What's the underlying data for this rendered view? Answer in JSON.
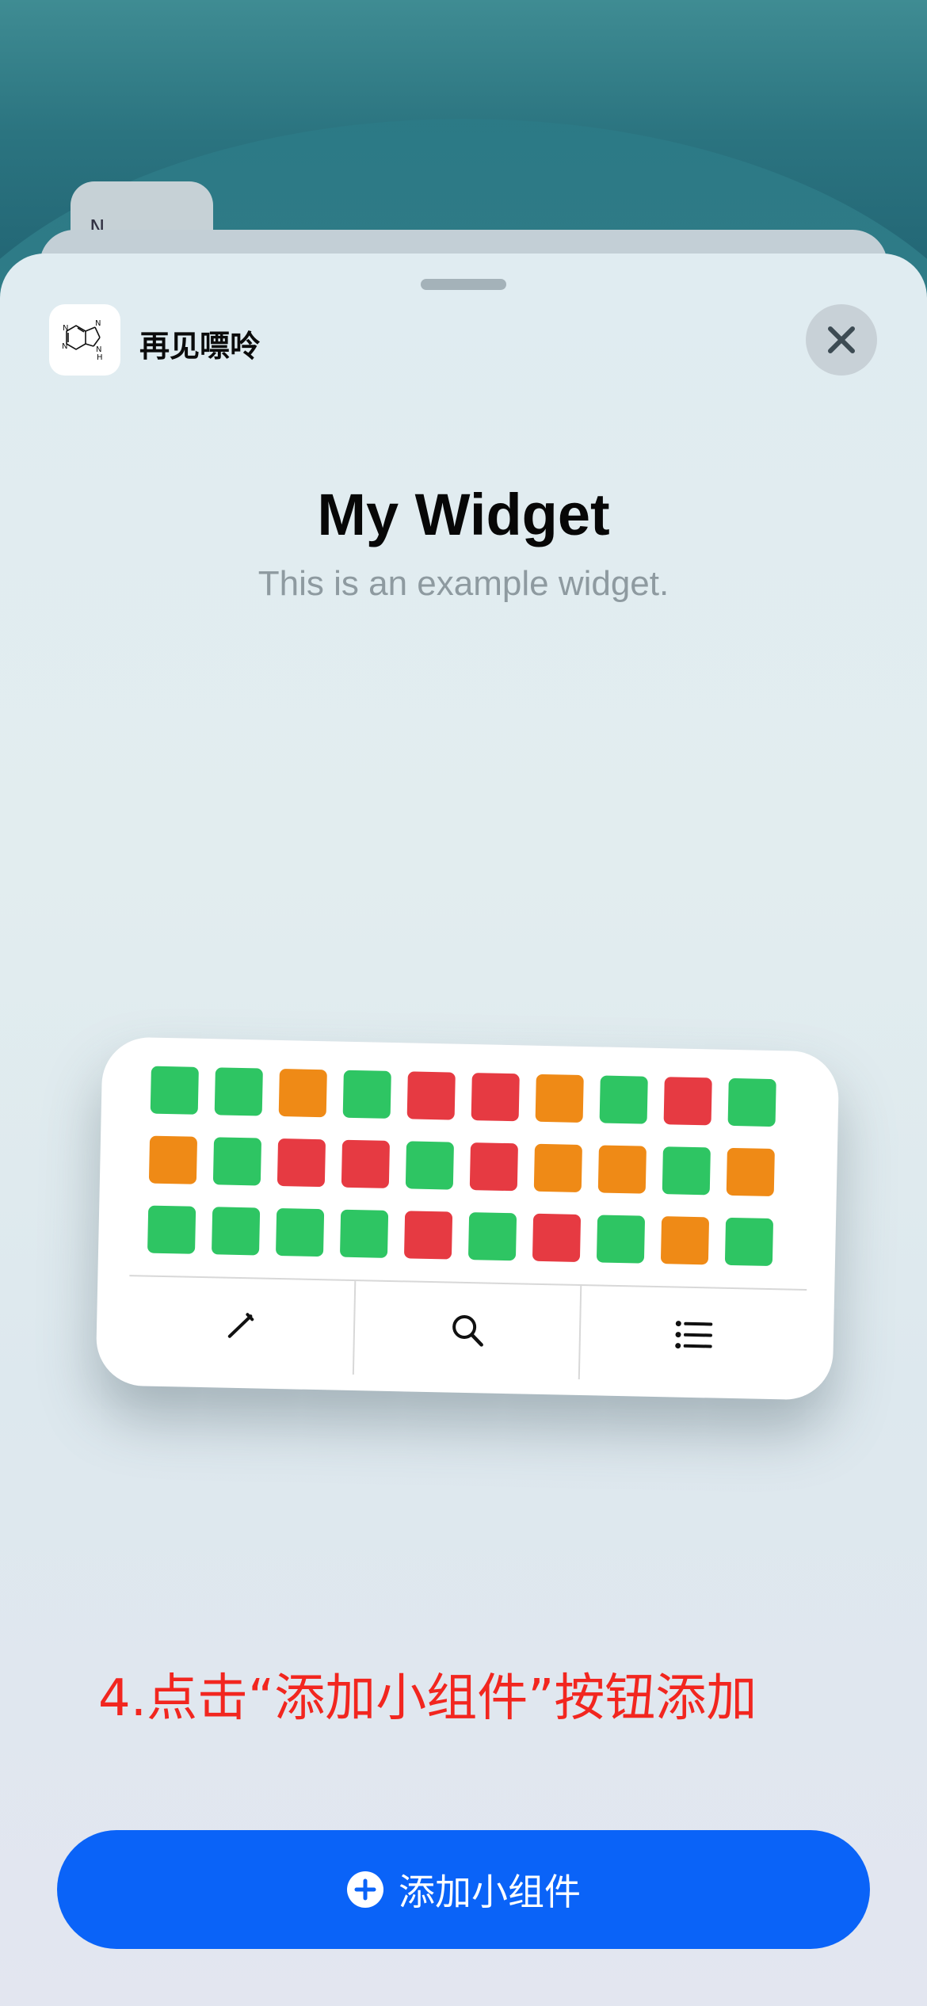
{
  "app": {
    "name": "再见嘌呤",
    "icon": "purine-molecule-icon",
    "ghost_icon_text": "N"
  },
  "sheet": {
    "title": "My Widget",
    "subtitle": "This is an example widget.",
    "close_icon": "close-icon"
  },
  "widget": {
    "colors": {
      "green": "#2ec563",
      "orange": "#ef8a16",
      "red": "#e63a42"
    },
    "rows": [
      [
        "green",
        "green",
        "orange",
        "green",
        "red",
        "red",
        "orange",
        "green",
        "red",
        "green"
      ],
      [
        "orange",
        "green",
        "red",
        "red",
        "green",
        "red",
        "orange",
        "orange",
        "green",
        "orange"
      ],
      [
        "green",
        "green",
        "green",
        "green",
        "red",
        "green",
        "red",
        "green",
        "orange",
        "green"
      ]
    ],
    "toolbar": [
      {
        "icon": "pencil-icon"
      },
      {
        "icon": "search-icon"
      },
      {
        "icon": "list-icon"
      }
    ]
  },
  "annotation": "4.点击“添加小组件”按钮添加",
  "add_button": {
    "label": "添加小组件",
    "icon": "plus-circle-icon",
    "color": "#0a63f8"
  }
}
